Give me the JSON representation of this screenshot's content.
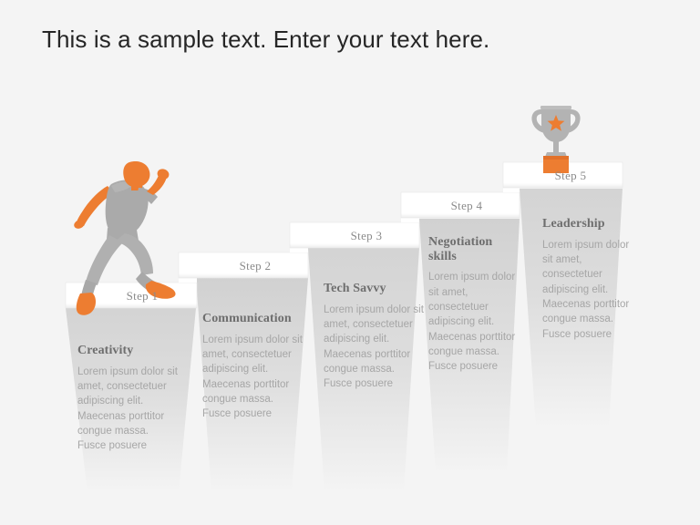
{
  "slide": {
    "title": "This is a sample text. Enter your text here.",
    "background_color": "#f4f4f4",
    "accent_color": "#ed7d31",
    "step_surface_color": "#ffffff",
    "shadow_color": "#d9d9d9",
    "label_color": "#8a8a8a",
    "heading_color": "#6e6e6e",
    "body_color": "#a6a6a6"
  },
  "icons": {
    "runner": "runner-icon",
    "trophy": "trophy-icon"
  },
  "steps": [
    {
      "step_label": "Step 1",
      "heading": "Creativity",
      "body": "Lorem ipsum dolor sit amet, consectetuer adipiscing elit. Maecenas porttitor congue massa. Fusce posuere"
    },
    {
      "step_label": "Step 2",
      "heading": "Communication",
      "body": "Lorem ipsum dolor sit amet, consectetuer adipiscing elit. Maecenas porttitor congue massa. Fusce posuere"
    },
    {
      "step_label": "Step 3",
      "heading": "Tech Savvy",
      "body": "Lorem ipsum dolor sit amet, consectetuer adipiscing elit. Maecenas porttitor congue massa. Fusce posuere"
    },
    {
      "step_label": "Step 4",
      "heading": "Negotiation skills",
      "body": "Lorem ipsum dolor sit amet, consectetuer adipiscing elit. Maecenas porttitor congue massa. Fusce posuere"
    },
    {
      "step_label": "Step 5",
      "heading": "Leadership",
      "body": "Lorem ipsum dolor sit amet, consectetuer adipiscing elit. Maecenas porttitor congue massa. Fusce posuere"
    }
  ]
}
